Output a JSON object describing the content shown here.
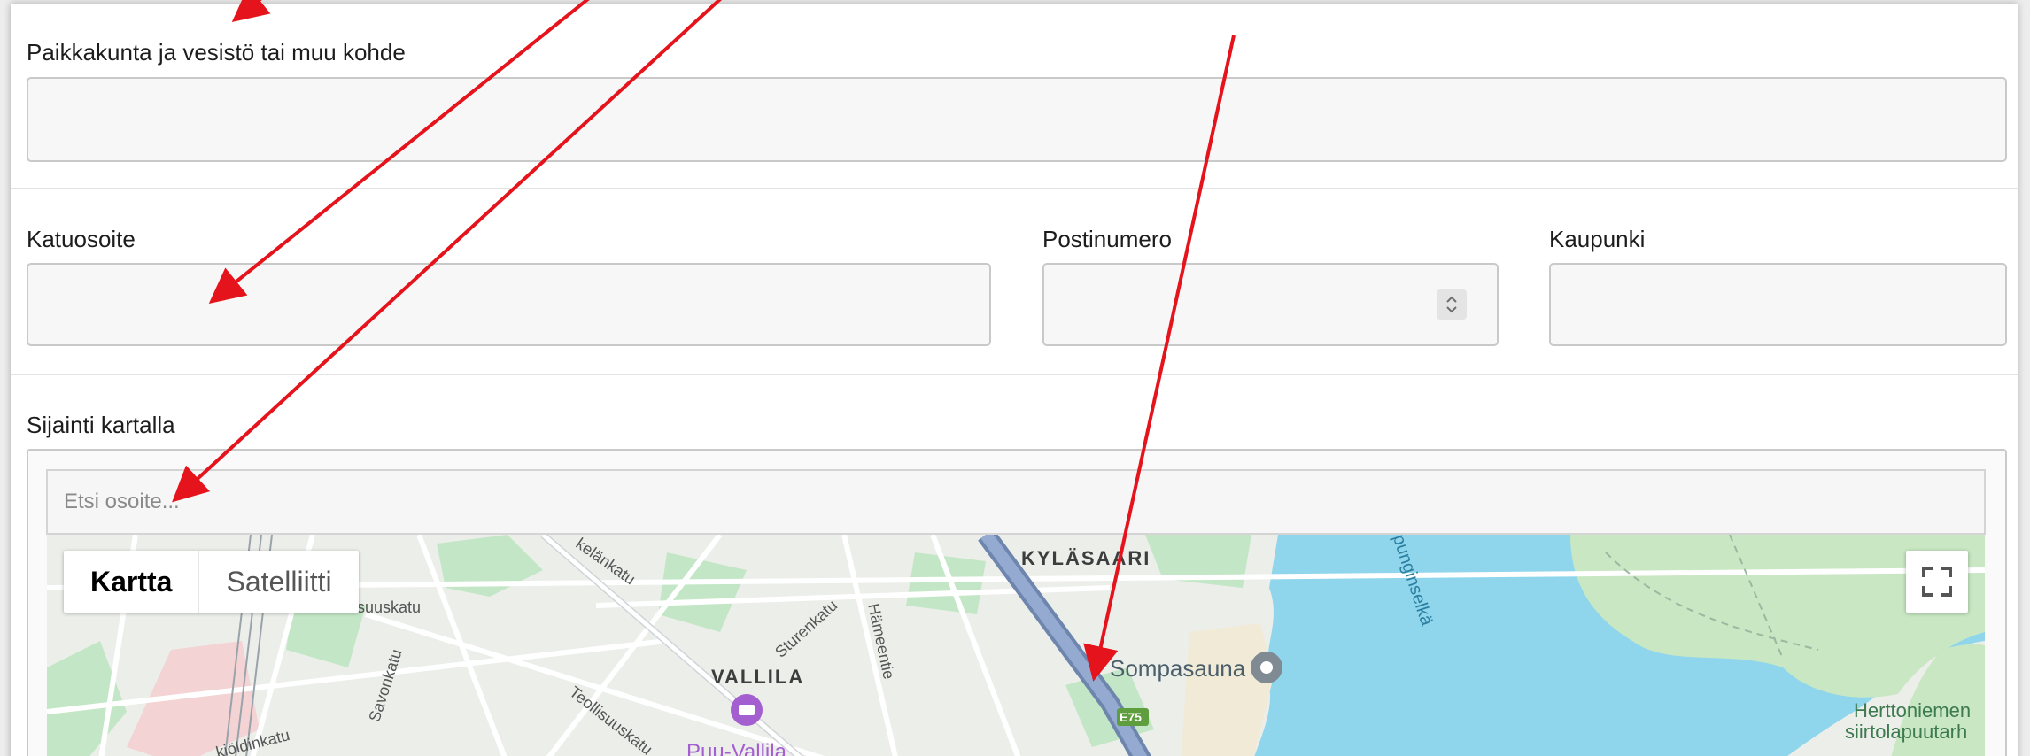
{
  "form": {
    "place_label": "Paikkakunta ja vesistö tai muu kohde",
    "street_label": "Katuosoite",
    "postal_label": "Postinumero",
    "city_label": "Kaupunki",
    "map_label": "Sijainti kartalla",
    "search_placeholder": "Etsi osoite..."
  },
  "map": {
    "type_buttons": [
      "Kartta",
      "Satelliitti"
    ],
    "active_type": "Kartta",
    "labels": {
      "kylasaari": "KYLÄSAARI",
      "vallila": "VALLILA",
      "sompasauna": "Sompasauna",
      "puu_vallila": "Puu-Vallila",
      "herttoniemen_1": "Herttoniemen",
      "herttoniemen_2": "siirtolapuutarh",
      "e75": "E75",
      "kelankatu": "kelänkatu",
      "suuskatu": "suuskatu",
      "sturenkatu": "Sturenkatu",
      "hameentie": "Hämeentie",
      "teollisuuskatu": "Teollisuuskatu",
      "savonkatu": "Savonkatu",
      "kioldinkatu": "kiöldinkatu",
      "vanhankaupunginselka": "punginselkä"
    },
    "colors": {
      "water": "#8fd6ec",
      "park": "#c3e7c6",
      "road": "#ffffff",
      "highway": "#8aa3c8",
      "land": "#eceeea"
    }
  },
  "annotation_color": "#e5131c"
}
